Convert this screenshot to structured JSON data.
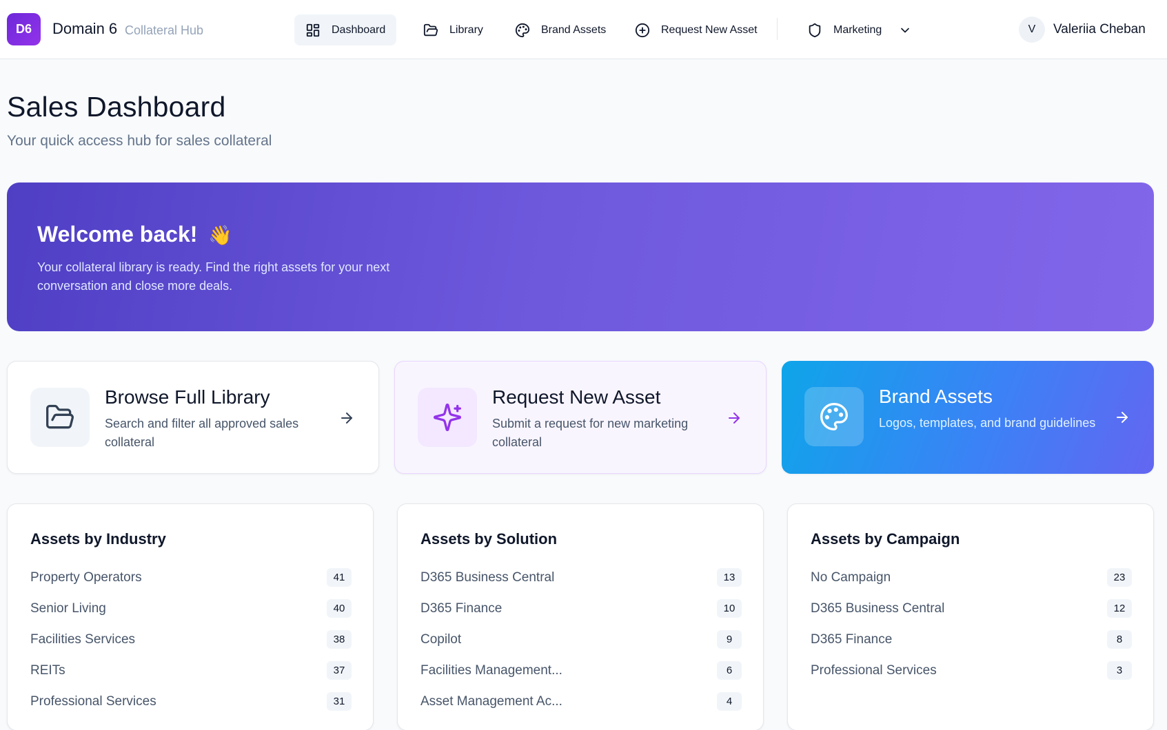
{
  "header": {
    "logo_text": "D6",
    "brand_name": "Domain 6",
    "brand_sub": "Collateral Hub",
    "nav": [
      {
        "label": "Dashboard",
        "icon": "dashboard-grid-icon"
      },
      {
        "label": "Library",
        "icon": "folder-icon"
      },
      {
        "label": "Brand Assets",
        "icon": "palette-icon"
      },
      {
        "label": "Request New Asset",
        "icon": "plus-circle-icon"
      }
    ],
    "role": {
      "label": "Marketing",
      "icon": "shield-icon"
    },
    "user": {
      "initial": "V",
      "name": "Valeriia Cheban"
    }
  },
  "page": {
    "title": "Sales Dashboard",
    "subtitle": "Your quick access hub for sales collateral"
  },
  "banner": {
    "title": "Welcome back!",
    "emoji": "👋",
    "text": "Your collateral library is ready. Find the right assets for your next conversation and close more deals."
  },
  "actions": [
    {
      "title": "Browse Full Library",
      "desc": "Search and filter all approved sales collateral",
      "icon": "folder-open-icon"
    },
    {
      "title": "Request New Asset",
      "desc": "Submit a request for new marketing collateral",
      "icon": "sparkles-icon"
    },
    {
      "title": "Brand Assets",
      "desc": "Logos, templates, and brand guidelines",
      "icon": "palette-icon"
    }
  ],
  "stats": {
    "industry": {
      "title": "Assets by Industry",
      "items": [
        {
          "label": "Property Operators",
          "count": "41"
        },
        {
          "label": "Senior Living",
          "count": "40"
        },
        {
          "label": "Facilities Services",
          "count": "38"
        },
        {
          "label": "REITs",
          "count": "37"
        },
        {
          "label": "Professional Services",
          "count": "31"
        }
      ]
    },
    "solution": {
      "title": "Assets by Solution",
      "items": [
        {
          "label": "D365 Business Central",
          "count": "13"
        },
        {
          "label": "D365 Finance",
          "count": "10"
        },
        {
          "label": "Copilot",
          "count": "9"
        },
        {
          "label": "Facilities Management...",
          "count": "6"
        },
        {
          "label": "Asset Management Ac...",
          "count": "4"
        }
      ]
    },
    "campaign": {
      "title": "Assets by Campaign",
      "items": [
        {
          "label": "No Campaign",
          "count": "23"
        },
        {
          "label": "D365 Business Central",
          "count": "12"
        },
        {
          "label": "D365 Finance",
          "count": "8"
        },
        {
          "label": "Professional Services",
          "count": "3"
        }
      ]
    }
  },
  "colors": {
    "brand_purple": "#7c3aed",
    "banner_start": "#4f3fc4",
    "banner_end": "#8266ea",
    "brand_card_start": "#0ea5e9",
    "brand_card_end": "#6366f1"
  }
}
